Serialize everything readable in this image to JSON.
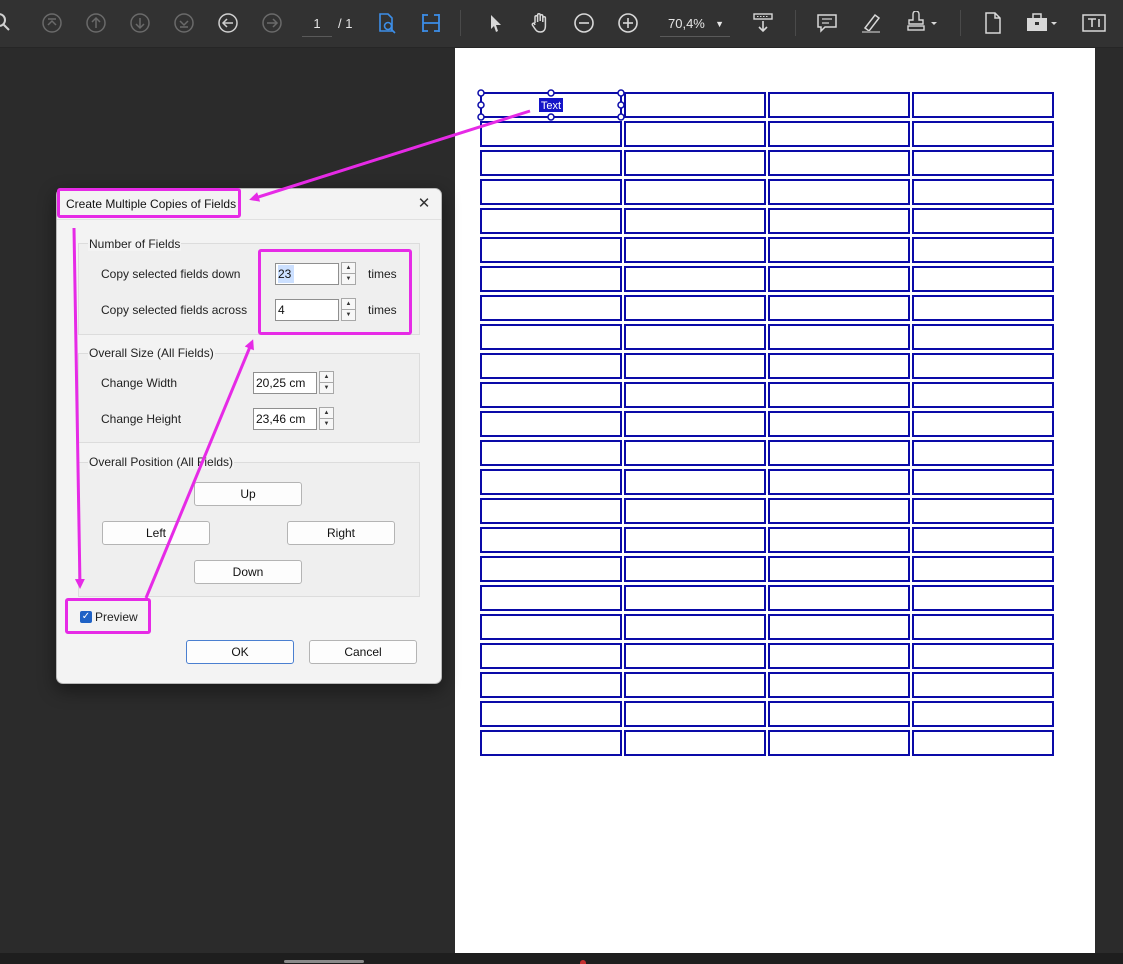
{
  "toolbar": {
    "page_current": "1",
    "page_total": "/ 1",
    "zoom": "70,4%"
  },
  "field_sample_text": "Text",
  "grid": {
    "rows": 23,
    "cols": 4,
    "color": "#0a0aa8"
  },
  "dialog": {
    "title": "Create Multiple Copies of Fields",
    "number_group": {
      "title": "Number of Fields",
      "down_label": "Copy selected fields down",
      "down_value": "23",
      "across_label": "Copy selected fields across",
      "across_value": "4",
      "times": "times"
    },
    "size_group": {
      "title": "Overall Size (All Fields)",
      "width_label": "Change Width",
      "width_value": "20,25 cm",
      "height_label": "Change Height",
      "height_value": "23,46 cm"
    },
    "position_group": {
      "title": "Overall Position (All Fields)",
      "up": "Up",
      "left": "Left",
      "right": "Right",
      "down": "Down"
    },
    "preview_label": "Preview",
    "ok": "OK",
    "cancel": "Cancel"
  },
  "colors": {
    "annotation": "#e62ae6",
    "accent": "#1f62c6"
  }
}
